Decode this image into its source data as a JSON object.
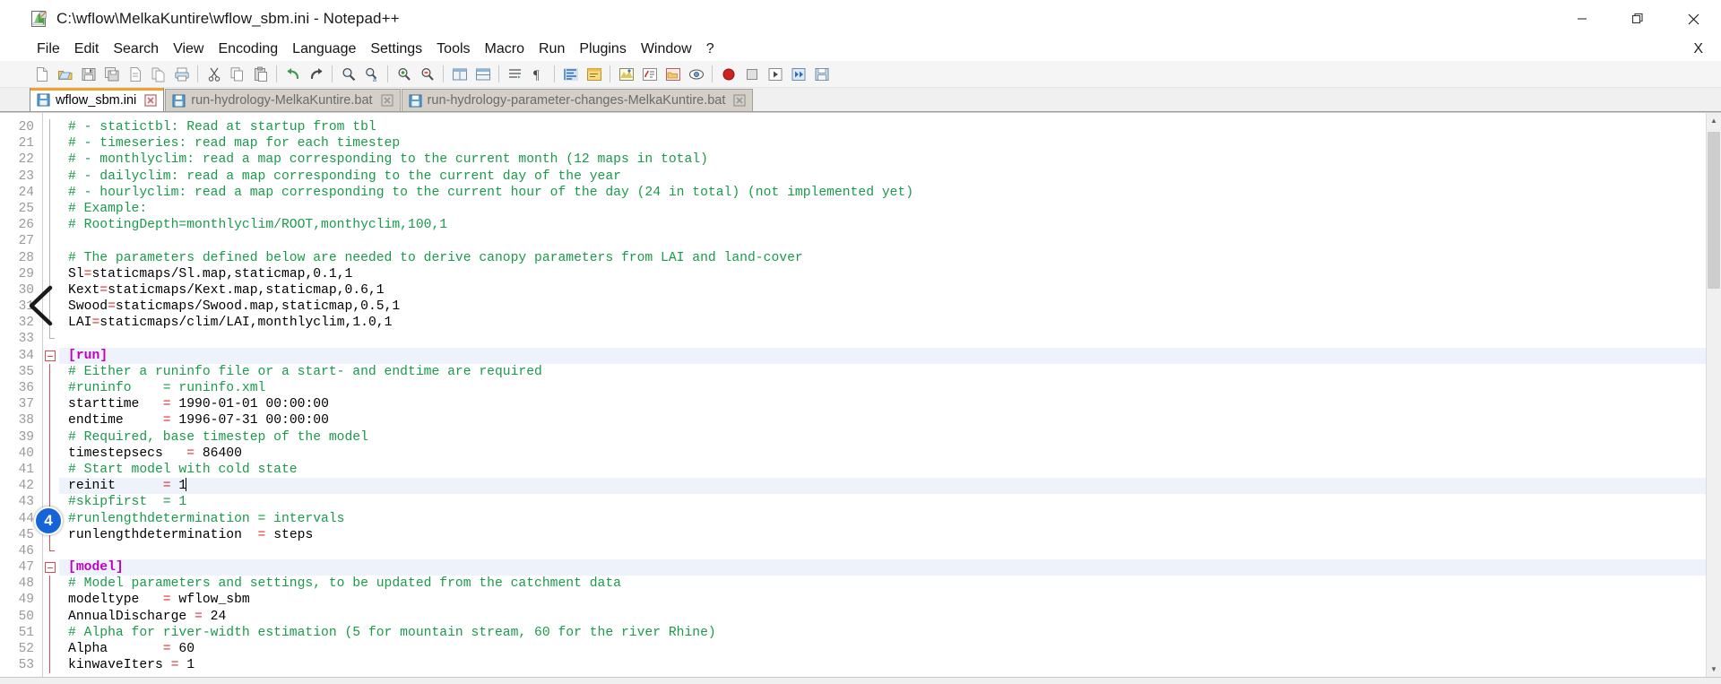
{
  "window": {
    "title": "C:\\wflow\\MelkaKuntire\\wflow_sbm.ini - Notepad++",
    "app_icon": "notepad-plus-plus-icon",
    "minimize_label": "—",
    "maximize_label": "❐",
    "close_label": "✕"
  },
  "menu": {
    "items": [
      {
        "label": "File"
      },
      {
        "label": "Edit"
      },
      {
        "label": "Search"
      },
      {
        "label": "View"
      },
      {
        "label": "Encoding"
      },
      {
        "label": "Language"
      },
      {
        "label": "Settings"
      },
      {
        "label": "Tools"
      },
      {
        "label": "Macro"
      },
      {
        "label": "Run"
      },
      {
        "label": "Plugins"
      },
      {
        "label": "Window"
      },
      {
        "label": "?"
      }
    ],
    "close_document_label": "X"
  },
  "toolbar": {
    "buttons": [
      {
        "name": "new-file-icon",
        "tooltip": "New"
      },
      {
        "name": "open-file-icon",
        "tooltip": "Open"
      },
      {
        "name": "save-icon",
        "tooltip": "Save"
      },
      {
        "name": "save-all-icon",
        "tooltip": "Save All"
      },
      {
        "name": "close-document-icon",
        "tooltip": "Close"
      },
      {
        "name": "close-all-documents-icon",
        "tooltip": "Close All"
      },
      {
        "name": "print-icon",
        "tooltip": "Print"
      },
      {
        "sep": true
      },
      {
        "name": "cut-icon",
        "tooltip": "Cut"
      },
      {
        "name": "copy-icon",
        "tooltip": "Copy"
      },
      {
        "name": "paste-icon",
        "tooltip": "Paste"
      },
      {
        "sep": true
      },
      {
        "name": "undo-icon",
        "tooltip": "Undo"
      },
      {
        "name": "redo-icon",
        "tooltip": "Redo"
      },
      {
        "sep": true
      },
      {
        "name": "find-icon",
        "tooltip": "Find"
      },
      {
        "name": "replace-icon",
        "tooltip": "Replace"
      },
      {
        "sep": true
      },
      {
        "name": "zoom-in-icon",
        "tooltip": "Zoom In"
      },
      {
        "name": "zoom-out-icon",
        "tooltip": "Zoom Out"
      },
      {
        "sep": true
      },
      {
        "name": "sync-vertical-scrolling-icon",
        "tooltip": "Synchronize Vertical Scrolling"
      },
      {
        "name": "sync-horizontal-scrolling-icon",
        "tooltip": "Synchronize Horizontal Scrolling"
      },
      {
        "sep": true
      },
      {
        "name": "word-wrap-icon",
        "tooltip": "Word wrap"
      },
      {
        "name": "show-all-characters-icon",
        "tooltip": "Show All Characters"
      },
      {
        "sep": true
      },
      {
        "name": "indent-guide-icon",
        "tooltip": "Show Indent Guide"
      },
      {
        "name": "user-defined-language-icon",
        "tooltip": "User-Defined Dialogue"
      },
      {
        "sep": true
      },
      {
        "name": "document-map-icon",
        "tooltip": "Document Map"
      },
      {
        "name": "function-list-icon",
        "tooltip": "Function List"
      },
      {
        "name": "folder-as-workspace-icon",
        "tooltip": "Folder as Workspace"
      },
      {
        "name": "monitoring-icon",
        "tooltip": "Monitoring"
      },
      {
        "sep": true
      },
      {
        "name": "record-macro-icon",
        "tooltip": "Start Recording"
      },
      {
        "name": "stop-macro-icon",
        "tooltip": "Stop Recording"
      },
      {
        "name": "play-macro-icon",
        "tooltip": "Playback"
      },
      {
        "name": "run-macro-multiple-icon",
        "tooltip": "Run a Macro Multiple Times"
      },
      {
        "name": "save-macro-icon",
        "tooltip": "Save Current Recorded Macro"
      }
    ]
  },
  "tabs": [
    {
      "label": "wflow_sbm.ini",
      "active": true,
      "icon": "saved-file-icon",
      "close": "close-tab-icon"
    },
    {
      "label": "run-hydrology-MelkaKuntire.bat",
      "active": false,
      "icon": "saved-file-icon",
      "close": "close-tab-icon"
    },
    {
      "label": "run-hydrology-parameter-changes-MelkaKuntire.bat",
      "active": false,
      "icon": "saved-file-icon",
      "close": "close-tab-icon"
    }
  ],
  "editor": {
    "first_line_number": 20,
    "current_line_number": 42,
    "lines": [
      {
        "n": 20,
        "fold": "grey-line",
        "tokens": [
          {
            "t": "comment",
            "v": "# - statictbl: Read at startup from tbl"
          }
        ]
      },
      {
        "n": 21,
        "fold": "grey-line",
        "tokens": [
          {
            "t": "comment",
            "v": "# - timeseries: read map for each timestep"
          }
        ]
      },
      {
        "n": 22,
        "fold": "grey-line",
        "tokens": [
          {
            "t": "comment",
            "v": "# - monthlyclim: read a map corresponding to the current month (12 maps in total)"
          }
        ]
      },
      {
        "n": 23,
        "fold": "grey-line",
        "tokens": [
          {
            "t": "comment",
            "v": "# - dailyclim: read a map corresponding to the current day of the year"
          }
        ]
      },
      {
        "n": 24,
        "fold": "grey-line",
        "tokens": [
          {
            "t": "comment",
            "v": "# - hourlyclim: read a map corresponding to the current hour of the day (24 in total) (not implemented yet)"
          }
        ]
      },
      {
        "n": 25,
        "fold": "grey-line",
        "tokens": [
          {
            "t": "comment",
            "v": "# Example:"
          }
        ]
      },
      {
        "n": 26,
        "fold": "grey-line",
        "tokens": [
          {
            "t": "comment",
            "v": "# RootingDepth=monthlyclim/ROOT,monthyclim,100,1"
          }
        ]
      },
      {
        "n": 27,
        "fold": "grey-line",
        "tokens": [
          {
            "t": "plain",
            "v": ""
          }
        ]
      },
      {
        "n": 28,
        "fold": "grey-line",
        "tokens": [
          {
            "t": "comment",
            "v": "# The parameters defined below are needed to derive canopy parameters from LAI and land-cover"
          }
        ]
      },
      {
        "n": 29,
        "fold": "grey-line",
        "tokens": [
          {
            "t": "plain",
            "v": "Sl"
          },
          {
            "t": "eq",
            "v": "="
          },
          {
            "t": "plain",
            "v": "staticmaps/Sl.map,staticmap,0.1,1"
          }
        ]
      },
      {
        "n": 30,
        "fold": "grey-line",
        "tokens": [
          {
            "t": "plain",
            "v": "Kext"
          },
          {
            "t": "eq",
            "v": "="
          },
          {
            "t": "plain",
            "v": "staticmaps/Kext.map,staticmap,0.6,1"
          }
        ]
      },
      {
        "n": 31,
        "fold": "grey-line",
        "tokens": [
          {
            "t": "plain",
            "v": "Swood"
          },
          {
            "t": "eq",
            "v": "="
          },
          {
            "t": "plain",
            "v": "staticmaps/Swood.map,staticmap,0.5,1"
          }
        ]
      },
      {
        "n": 32,
        "fold": "grey-line",
        "tokens": [
          {
            "t": "plain",
            "v": "LAI"
          },
          {
            "t": "eq",
            "v": "="
          },
          {
            "t": "plain",
            "v": "staticmaps/clim/LAI,monthlyclim,1.0,1"
          }
        ]
      },
      {
        "n": 33,
        "fold": "grey-end",
        "tokens": [
          {
            "t": "plain",
            "v": ""
          }
        ]
      },
      {
        "n": 34,
        "fold": "box",
        "highlight": true,
        "tokens": [
          {
            "t": "section",
            "v": "[run]"
          }
        ]
      },
      {
        "n": 35,
        "fold": "line",
        "tokens": [
          {
            "t": "comment",
            "v": "# Either a runinfo file or a start- and endtime are required"
          }
        ]
      },
      {
        "n": 36,
        "fold": "line",
        "tokens": [
          {
            "t": "comment",
            "v": "#runinfo    = runinfo.xml"
          }
        ]
      },
      {
        "n": 37,
        "fold": "line",
        "tokens": [
          {
            "t": "plain",
            "v": "starttime   "
          },
          {
            "t": "eq",
            "v": "="
          },
          {
            "t": "plain",
            "v": " 1990-01-01 00:00:00"
          }
        ]
      },
      {
        "n": 38,
        "fold": "line",
        "tokens": [
          {
            "t": "plain",
            "v": "endtime     "
          },
          {
            "t": "eq",
            "v": "="
          },
          {
            "t": "plain",
            "v": " 1996-07-31 00:00:00"
          }
        ]
      },
      {
        "n": 39,
        "fold": "line",
        "tokens": [
          {
            "t": "comment",
            "v": "# Required, base timestep of the model"
          }
        ]
      },
      {
        "n": 40,
        "fold": "line",
        "tokens": [
          {
            "t": "plain",
            "v": "timestepsecs   "
          },
          {
            "t": "eq",
            "v": "="
          },
          {
            "t": "plain",
            "v": " 86400"
          }
        ]
      },
      {
        "n": 41,
        "fold": "line",
        "tokens": [
          {
            "t": "comment",
            "v": "# Start model with cold state"
          }
        ]
      },
      {
        "n": 42,
        "fold": "line",
        "highlight": true,
        "caret": true,
        "tokens": [
          {
            "t": "plain",
            "v": "reinit      "
          },
          {
            "t": "eq",
            "v": "="
          },
          {
            "t": "plain",
            "v": " 1"
          }
        ]
      },
      {
        "n": 43,
        "fold": "line",
        "tokens": [
          {
            "t": "comment",
            "v": "#skipfirst  = 1"
          }
        ]
      },
      {
        "n": 44,
        "fold": "line",
        "tokens": [
          {
            "t": "comment",
            "v": "#runlengthdetermination = intervals"
          }
        ]
      },
      {
        "n": 45,
        "fold": "line",
        "tokens": [
          {
            "t": "plain",
            "v": "runlengthdetermination  "
          },
          {
            "t": "eq",
            "v": "="
          },
          {
            "t": "plain",
            "v": " steps"
          }
        ]
      },
      {
        "n": 46,
        "fold": "end",
        "tokens": [
          {
            "t": "plain",
            "v": ""
          }
        ]
      },
      {
        "n": 47,
        "fold": "box",
        "highlight": true,
        "tokens": [
          {
            "t": "section",
            "v": "[model]"
          }
        ]
      },
      {
        "n": 48,
        "fold": "line",
        "tokens": [
          {
            "t": "comment",
            "v": "# Model parameters and settings, to be updated from the catchment data"
          }
        ]
      },
      {
        "n": 49,
        "fold": "line",
        "tokens": [
          {
            "t": "plain",
            "v": "modeltype   "
          },
          {
            "t": "eq",
            "v": "="
          },
          {
            "t": "plain",
            "v": " wflow_sbm"
          }
        ]
      },
      {
        "n": 50,
        "fold": "line",
        "tokens": [
          {
            "t": "plain",
            "v": "AnnualDischarge "
          },
          {
            "t": "eq",
            "v": "="
          },
          {
            "t": "plain",
            "v": " 24"
          }
        ]
      },
      {
        "n": 51,
        "fold": "line",
        "tokens": [
          {
            "t": "comment",
            "v": "# Alpha for river-width estimation (5 for mountain stream, 60 for the river Rhine)"
          }
        ]
      },
      {
        "n": 52,
        "fold": "line",
        "tokens": [
          {
            "t": "plain",
            "v": "Alpha       "
          },
          {
            "t": "eq",
            "v": "="
          },
          {
            "t": "plain",
            "v": " 60"
          }
        ]
      },
      {
        "n": 53,
        "fold": "line",
        "tokens": [
          {
            "t": "plain",
            "v": "kinwaveIters "
          },
          {
            "t": "eq",
            "v": "="
          },
          {
            "t": "plain",
            "v": " 1"
          }
        ]
      }
    ]
  },
  "annotations": {
    "chevron_name": "chevron-left-annotation",
    "badge_number": "4"
  },
  "scrollbar": {
    "up_arrow": "▲",
    "down_arrow": "▼"
  },
  "colors": {
    "comment": "#1a9a4a",
    "section": "#c000c0",
    "operator": "#e03030",
    "current_line": "#eef2fb",
    "tab_active_accent": "#f0a030",
    "badge": "#1565d8"
  }
}
